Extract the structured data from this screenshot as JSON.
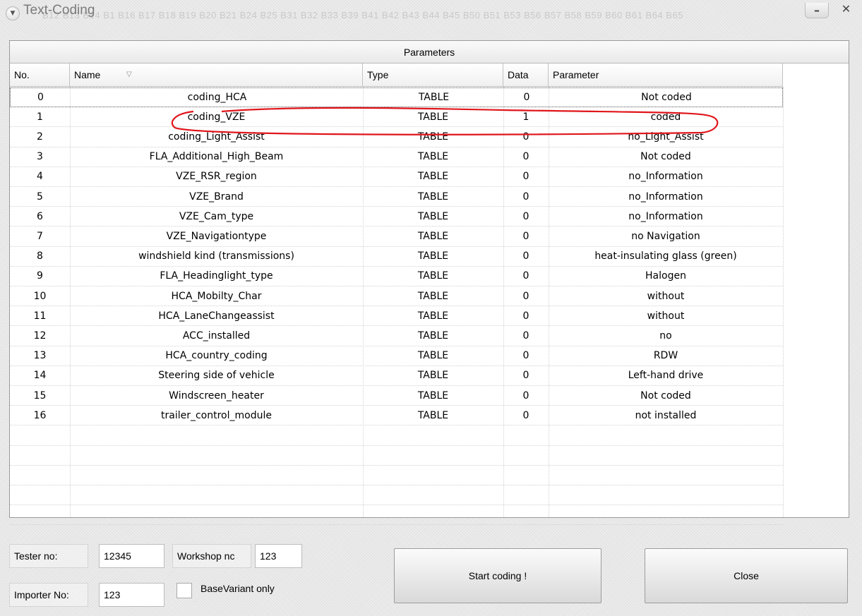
{
  "window": {
    "title": "Text-Coding",
    "title_strip": "B12 B13 B14 B1 B16 B17 B18 B19 B20 B21 B24 B25 B31 B32 B33 B39 B41 B42 B43 B44 B45 B50 B51 B53 B56 B57 B58 B59 B60 B61 B64 B65",
    "minimize_label": "–",
    "close_label": "✕"
  },
  "panel": {
    "header": "Parameters",
    "columns": {
      "no": "No.",
      "name": "Name",
      "type": "Type",
      "data": "Data",
      "parameter": "Parameter"
    },
    "rows": [
      {
        "no": "0",
        "name": "coding_HCA",
        "type": "TABLE",
        "data": "0",
        "parameter": "Not coded"
      },
      {
        "no": "1",
        "name": "coding_VZE",
        "type": "TABLE",
        "data": "1",
        "parameter": "coded"
      },
      {
        "no": "2",
        "name": "coding_Light_Assist",
        "type": "TABLE",
        "data": "0",
        "parameter": "no_Light_Assist"
      },
      {
        "no": "3",
        "name": "FLA_Additional_High_Beam",
        "type": "TABLE",
        "data": "0",
        "parameter": "Not coded"
      },
      {
        "no": "4",
        "name": "VZE_RSR_region",
        "type": "TABLE",
        "data": "0",
        "parameter": "no_Information"
      },
      {
        "no": "5",
        "name": "VZE_Brand",
        "type": "TABLE",
        "data": "0",
        "parameter": "no_Information"
      },
      {
        "no": "6",
        "name": "VZE_Cam_type",
        "type": "TABLE",
        "data": "0",
        "parameter": "no_Information"
      },
      {
        "no": "7",
        "name": "VZE_Navigationtype",
        "type": "TABLE",
        "data": "0",
        "parameter": "no Navigation"
      },
      {
        "no": "8",
        "name": "windshield kind (transmissions)",
        "type": "TABLE",
        "data": "0",
        "parameter": "heat-insulating glass (green)"
      },
      {
        "no": "9",
        "name": "FLA_Headinglight_type",
        "type": "TABLE",
        "data": "0",
        "parameter": "Halogen"
      },
      {
        "no": "10",
        "name": "HCA_Mobilty_Char",
        "type": "TABLE",
        "data": "0",
        "parameter": "without"
      },
      {
        "no": "11",
        "name": "HCA_LaneChangeassist",
        "type": "TABLE",
        "data": "0",
        "parameter": "without"
      },
      {
        "no": "12",
        "name": "ACC_installed",
        "type": "TABLE",
        "data": "0",
        "parameter": "no"
      },
      {
        "no": "13",
        "name": "HCA_country_coding",
        "type": "TABLE",
        "data": "0",
        "parameter": "RDW"
      },
      {
        "no": "14",
        "name": "Steering side of vehicle",
        "type": "TABLE",
        "data": "0",
        "parameter": "Left-hand drive"
      },
      {
        "no": "15",
        "name": "Windscreen_heater",
        "type": "TABLE",
        "data": "0",
        "parameter": "Not coded"
      },
      {
        "no": "16",
        "name": "trailer_control_module",
        "type": "TABLE",
        "data": "0",
        "parameter": "not installed"
      }
    ]
  },
  "annotation": {
    "color": "#e0161b"
  },
  "form": {
    "tester_label": "Tester no:",
    "tester_value": "12345",
    "workshop_label": "Workshop nc",
    "workshop_value": "123",
    "importer_label": "Importer No:",
    "importer_value": "123",
    "basevariant_label": "BaseVariant only",
    "basevariant_checked": false
  },
  "buttons": {
    "start": "Start coding !",
    "close": "Close"
  }
}
